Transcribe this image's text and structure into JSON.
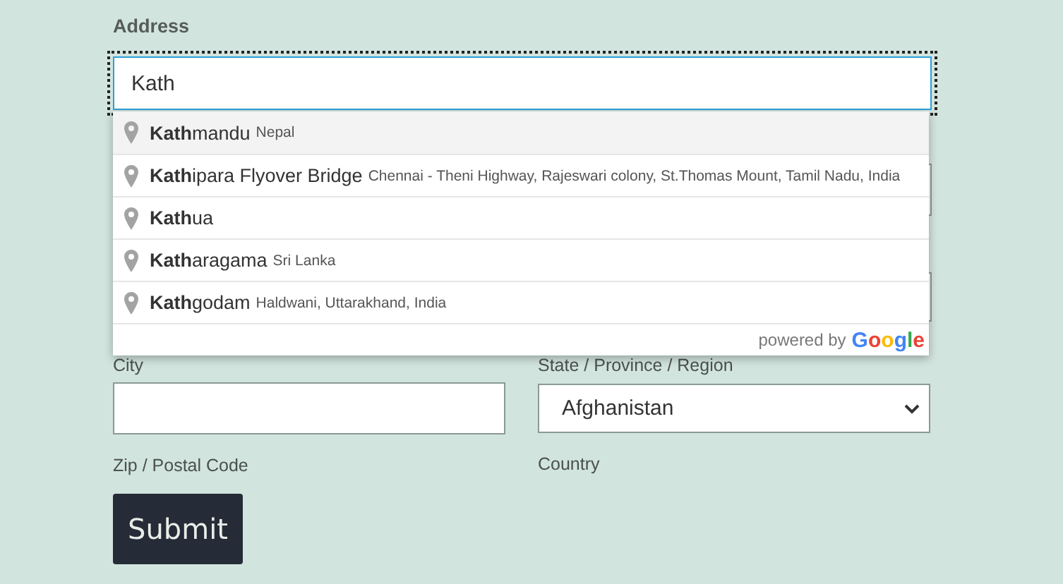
{
  "address": {
    "label": "Address",
    "value": "Kath",
    "focused": true
  },
  "suggestions": [
    {
      "main": "**Kath**mandu",
      "secondary": "Nepal",
      "selected": true
    },
    {
      "main": "**Kath**ipara Flyover Bridge",
      "secondary": "Chennai - Theni Highway, Rajeswari colony, St.Thomas Mount, Tamil Nadu, India",
      "selected": false
    },
    {
      "main": "**Kath**ua",
      "selected": false
    },
    {
      "main": "**Kath**aragama",
      "secondary": "Sri Lanka",
      "selected": false
    },
    {
      "main": "**Kath**godam",
      "secondary": "Haldwani, Uttarakhand, India",
      "selected": false
    }
  ],
  "attribution": {
    "prefix": "powered by",
    "brand": "Google"
  },
  "city": {
    "label": "City",
    "caption": "Zip / Postal Code"
  },
  "region": {
    "label": "State / Province / Region",
    "value": "Afghanistan",
    "caption": "Country"
  },
  "submit": "Submit"
}
